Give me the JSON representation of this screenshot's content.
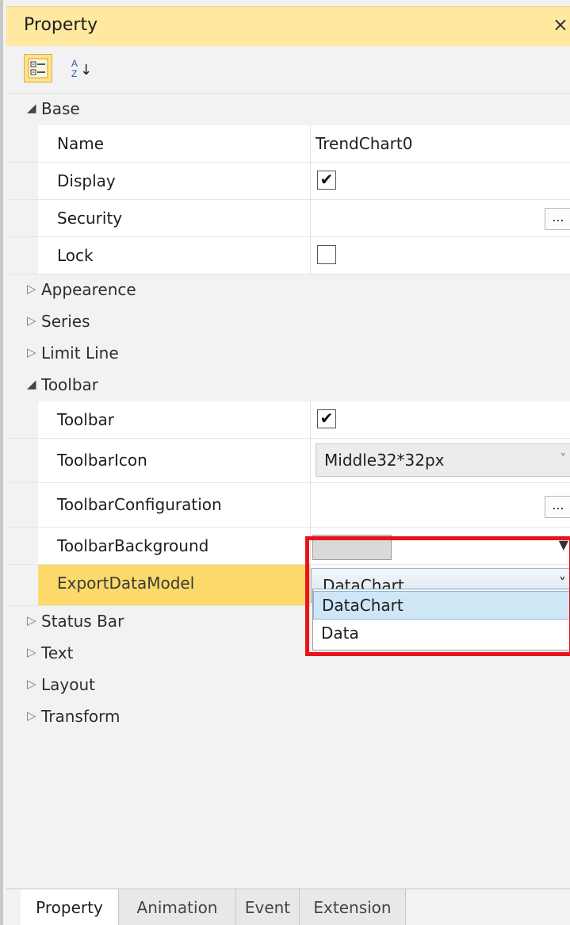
{
  "window": {
    "title": "Property",
    "close_glyph": "×"
  },
  "toolbar": {
    "buttons": [
      {
        "icon": "categorized-view-icon"
      },
      {
        "icon": "sort-alphabetical-icon",
        "glyph_top": "A",
        "glyph_bottom": "Z",
        "glyph_arrow": "↓"
      }
    ]
  },
  "grid": {
    "base": {
      "label": "Base",
      "arrow": "◢",
      "name_label": "Name",
      "name_value": "TrendChart0",
      "display_label": "Display",
      "display_checked": "✔",
      "security_label": "Security",
      "security_button": "...",
      "lock_label": "Lock",
      "lock_checked": ""
    },
    "collapsed_a": [
      {
        "label": "Appearence",
        "arrow": "▷"
      },
      {
        "label": "Series",
        "arrow": "▷"
      },
      {
        "label": "Limit Line",
        "arrow": "▷"
      }
    ],
    "toolbar_cat": {
      "label": "Toolbar",
      "arrow": "◢",
      "toolbar_label": "Toolbar",
      "toolbar_checked": "✔",
      "icon_label": "ToolbarIcon",
      "icon_value": "Middle32*32px",
      "icon_arrow": "˅",
      "config_label": "ToolbarConfiguration",
      "config_button": "...",
      "bg_label": "ToolbarBackground",
      "bg_color": "#d9d9d9",
      "bg_arrow": "▼",
      "export_label": "ExportDataModel",
      "export_value": "DataChart",
      "export_arrow": "˅"
    },
    "dropdown": {
      "options": [
        "DataChart",
        "Data"
      ],
      "selected": "DataChart"
    },
    "collapsed_b": [
      {
        "label": "Status Bar",
        "arrow": "▷"
      },
      {
        "label": "Text",
        "arrow": "▷"
      },
      {
        "label": "Layout",
        "arrow": "▷"
      },
      {
        "label": "Transform",
        "arrow": "▷"
      }
    ]
  },
  "tabs": [
    {
      "label": "Property",
      "active": true
    },
    {
      "label": "Animation"
    },
    {
      "label": "Event"
    },
    {
      "label": "Extension"
    }
  ],
  "colors": {
    "title_bg": "#ffe9a0",
    "selected_row": "#fcd96a",
    "highlight_border": "#e8141b",
    "dropdown_selected": "#cfe6f7"
  }
}
